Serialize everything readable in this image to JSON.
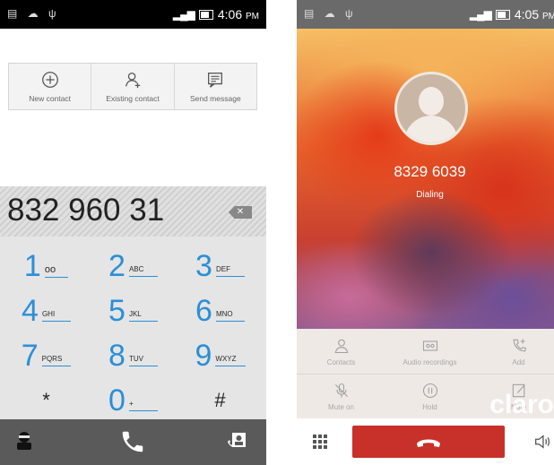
{
  "left_phone": {
    "status": {
      "time": "4:06",
      "ampm": "PM"
    },
    "actions": [
      {
        "label": "New contact",
        "icon": "add-circle-icon"
      },
      {
        "label": "Existing contact",
        "icon": "add-person-icon"
      },
      {
        "label": "Send message",
        "icon": "message-icon"
      }
    ],
    "dialed_number": "832 960 31",
    "keys": [
      {
        "digit": "1",
        "letters": "voicemail"
      },
      {
        "digit": "2",
        "letters": "ABC"
      },
      {
        "digit": "3",
        "letters": "DEF"
      },
      {
        "digit": "4",
        "letters": "GHI"
      },
      {
        "digit": "5",
        "letters": "JKL"
      },
      {
        "digit": "6",
        "letters": "MNO"
      },
      {
        "digit": "7",
        "letters": "PQRS"
      },
      {
        "digit": "8",
        "letters": "TUV"
      },
      {
        "digit": "9",
        "letters": "WXYZ"
      },
      {
        "digit": "*",
        "letters": ""
      },
      {
        "digit": "0",
        "letters": "+"
      },
      {
        "digit": "#",
        "letters": ""
      }
    ]
  },
  "right_phone": {
    "status": {
      "time": "4:05",
      "ampm": "PM"
    },
    "caller_number": "8329 6039",
    "call_status": "Dialing",
    "controls": [
      {
        "label": "Contacts",
        "icon": "contacts-icon"
      },
      {
        "label": "Audio recordings",
        "icon": "tape-icon"
      },
      {
        "label": "Add",
        "icon": "add-call-icon"
      },
      {
        "label": "Mute on",
        "icon": "mic-off-icon"
      },
      {
        "label": "Hold",
        "icon": "pause-icon"
      },
      {
        "label": "Note",
        "icon": "note-icon"
      }
    ],
    "watermark": "claro"
  },
  "colors": {
    "accent_blue": "#2b8fd6",
    "end_call_red": "#c8302a"
  }
}
